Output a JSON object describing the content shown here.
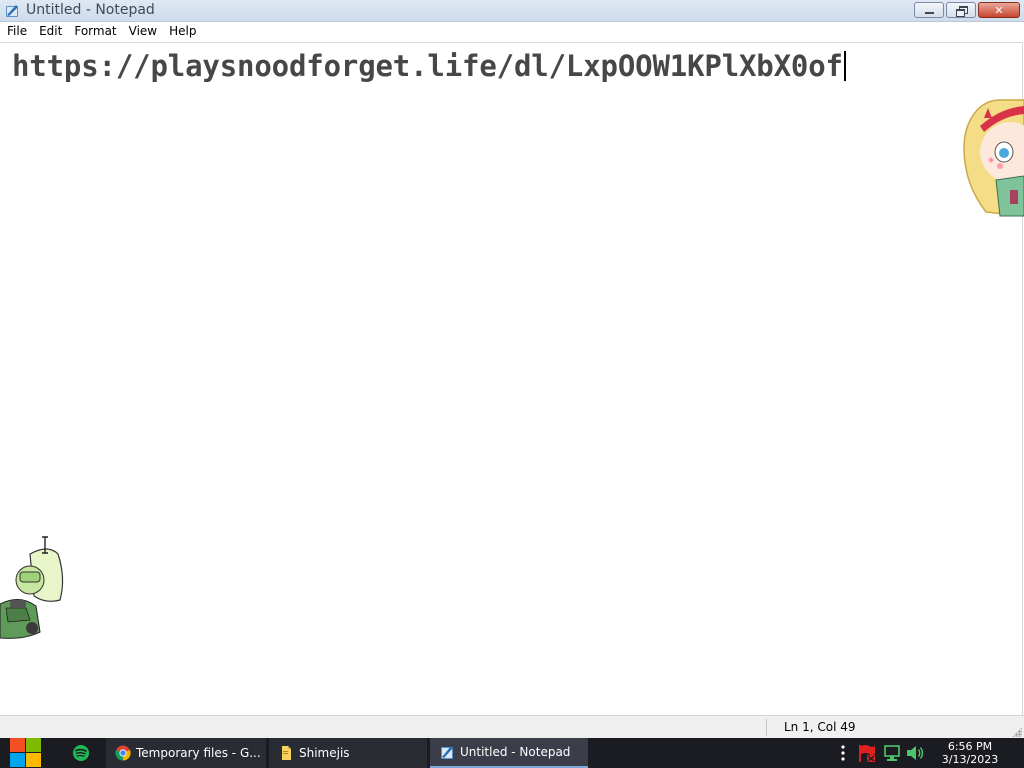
{
  "window": {
    "title": "Untitled - Notepad"
  },
  "menu": {
    "items": [
      "File",
      "Edit",
      "Format",
      "View",
      "Help"
    ]
  },
  "editor": {
    "text": "https://playsnoodforget.life/dl/LxpOOW1KPlXbX0of"
  },
  "status": {
    "position": "Ln 1, Col 49"
  },
  "taskbar": {
    "items": [
      {
        "label": "Temporary files - G...",
        "icon": "chrome-icon"
      },
      {
        "label": "Shimejis",
        "icon": "folder-icon"
      },
      {
        "label": "Untitled - Notepad",
        "icon": "notepad-icon",
        "active": true
      }
    ],
    "pinned": [
      "spotify-icon"
    ],
    "tray": [
      "overflow-icon",
      "action-center-flag-icon",
      "network-icon",
      "volume-icon"
    ]
  },
  "clock": {
    "time": "6:56 PM",
    "date": "3/13/2023"
  },
  "colors": {
    "taskbar": "#1b1c22",
    "titlebar": "#dfe8f3",
    "close_button": "#c8462f",
    "spotify": "#1db954",
    "start_red": "#f25022",
    "start_green": "#7fba00",
    "start_blue": "#00a4ef",
    "start_yellow": "#ffb900"
  },
  "desktop_mascots": [
    "star-butterfly-shimeji",
    "peridot-shimeji"
  ]
}
